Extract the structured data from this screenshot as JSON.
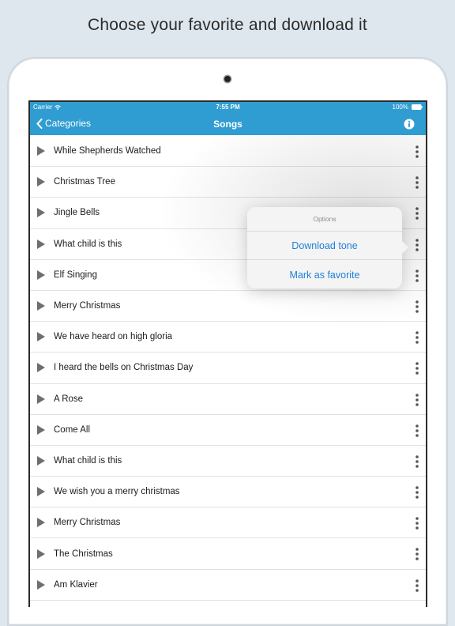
{
  "caption": "Choose your favorite and download it",
  "status_bar": {
    "carrier": "Carrier",
    "time": "7:55 PM",
    "battery": "100%"
  },
  "nav_bar": {
    "back_label": "Categories",
    "title": "Songs"
  },
  "songs": [
    "While Shepherds Watched",
    "Christmas Tree",
    "Jingle Bells",
    "What child is this",
    "Elf Singing",
    "Merry Christmas",
    "We have heard on high gloria",
    "I heard the bells on Christmas Day",
    "A Rose",
    "Come All",
    "What child is this",
    "We wish you a merry christmas",
    "Merry Christmas",
    "The Christmas",
    "Am Klavier"
  ],
  "popover": {
    "title": "Options",
    "download_label": "Download tone",
    "favorite_label": "Mark as favorite"
  },
  "colors": {
    "accent": "#2f9dd1",
    "link": "#1e7fd6"
  }
}
